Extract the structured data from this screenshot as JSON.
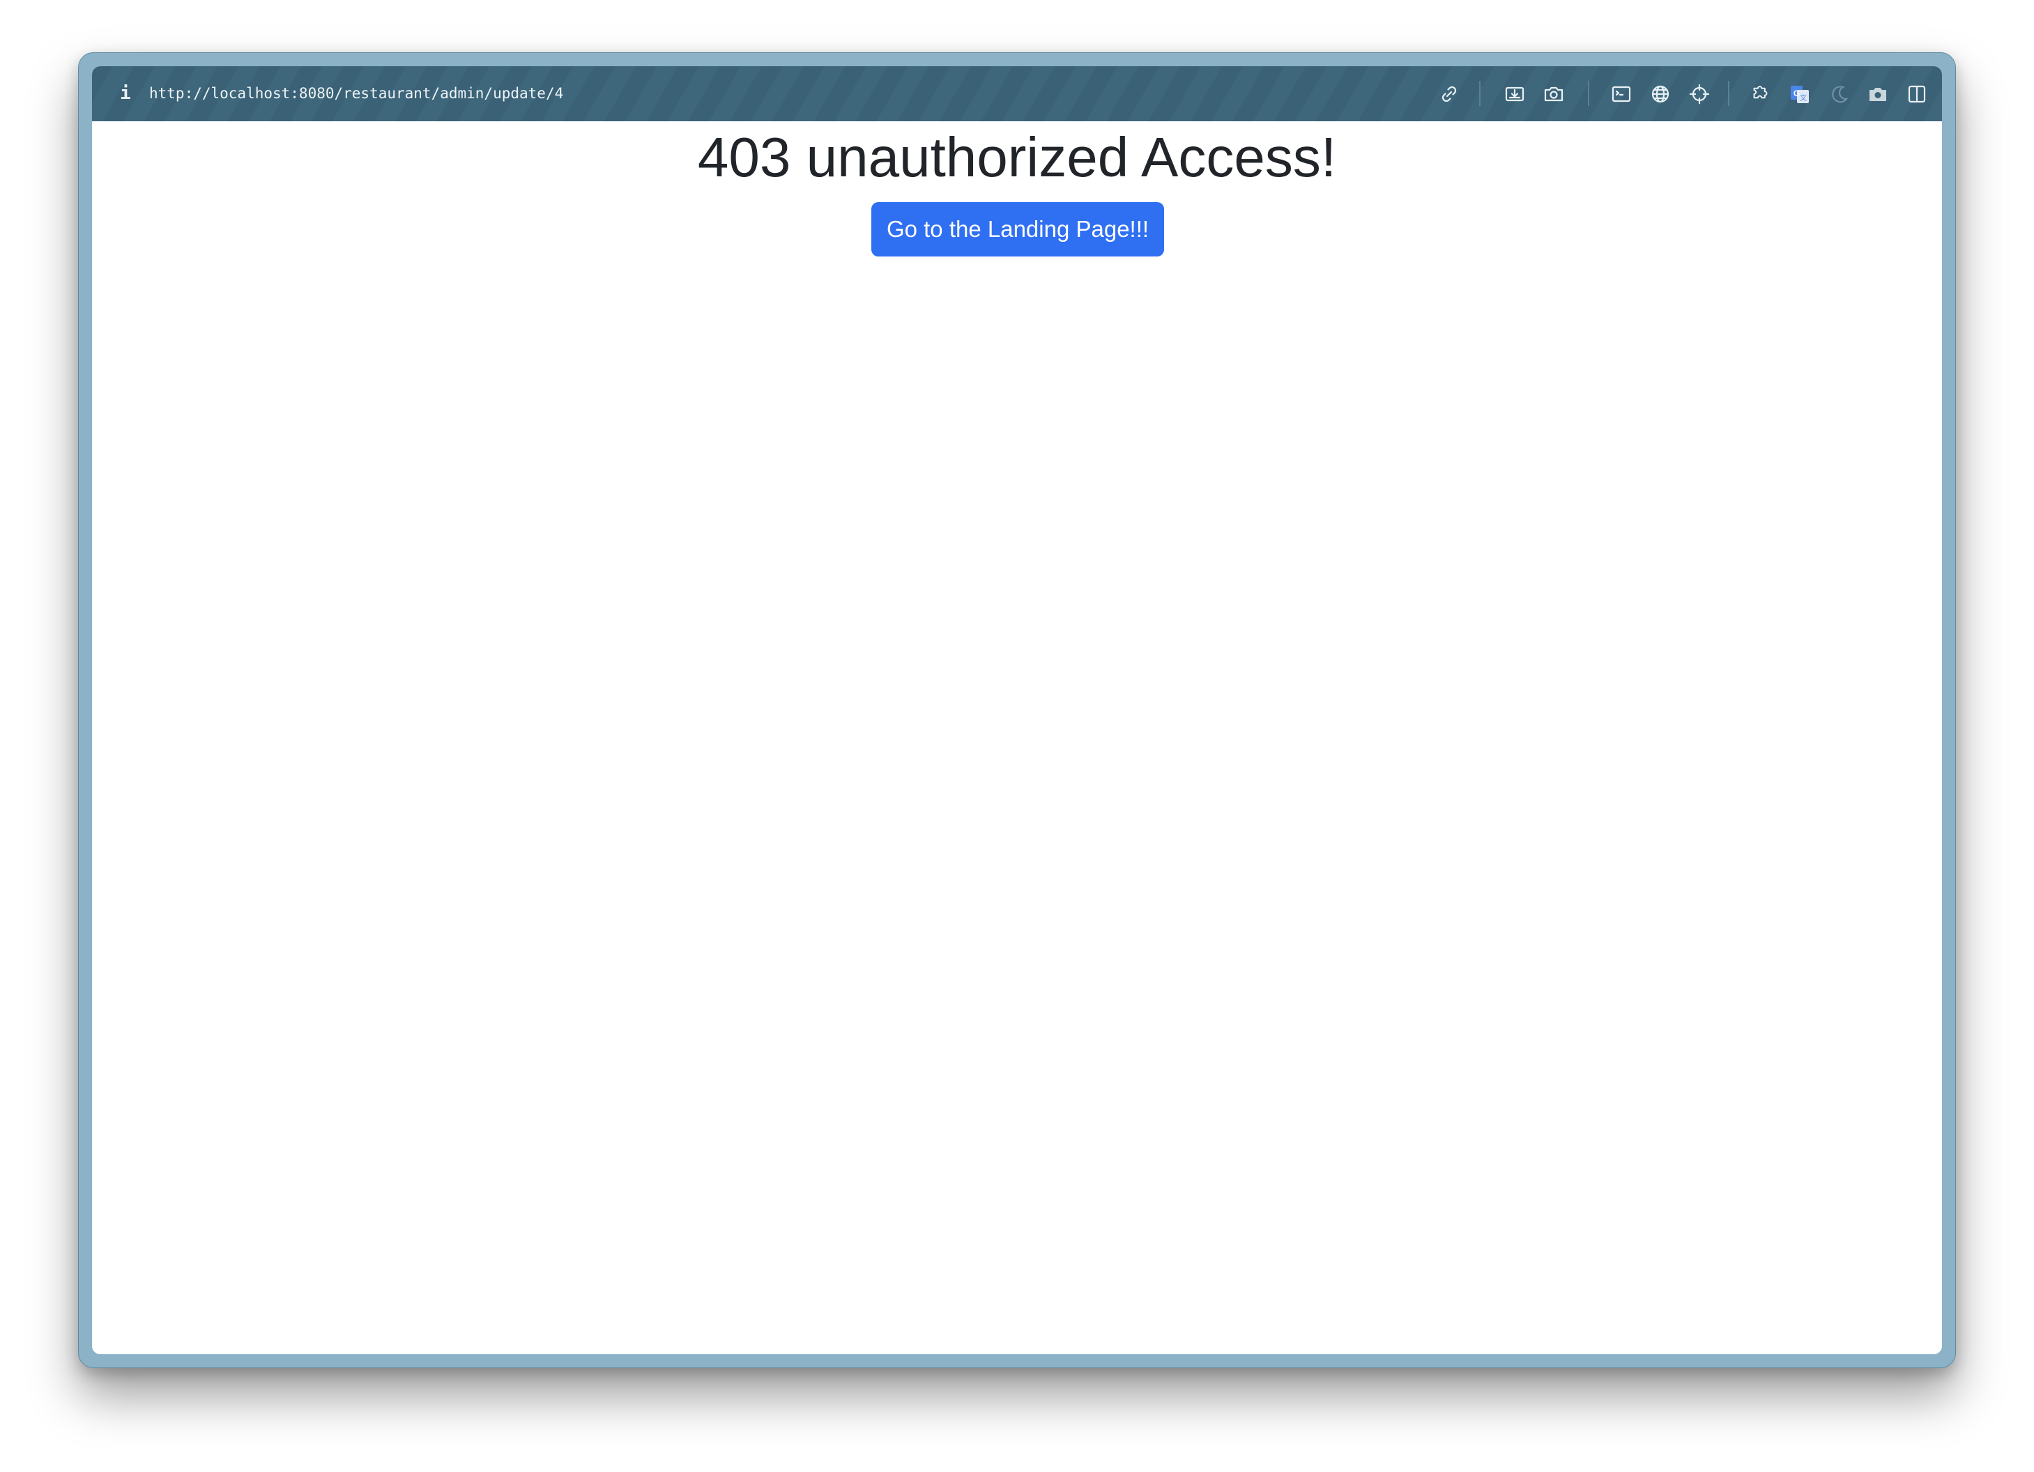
{
  "browser": {
    "url": "http://localhost:8080/restaurant/admin/update/4",
    "info_glyph": "i",
    "toolbar_icons": [
      "link-icon",
      "download-icon",
      "camera-icon",
      "terminal-icon",
      "globe-icon",
      "crosshair-icon",
      "puzzle-extension-icon",
      "translate-icon",
      "moon-icon",
      "screenshot-icon",
      "split-view-icon"
    ]
  },
  "page": {
    "heading": "403 unauthorized Access!",
    "button_label": "Go to the Landing Page!!!"
  },
  "colors": {
    "toolbar": "#3a6176",
    "window_frame": "#8cb2c8",
    "button": "#2f6ff2",
    "heading_text": "#212529"
  }
}
